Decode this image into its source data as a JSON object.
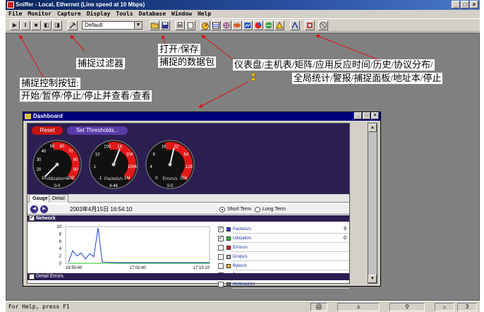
{
  "app": {
    "title": "Sniffer - Local, Ethernet (Line speed at 10 Mbps)",
    "window_buttons": [
      "_",
      "□",
      "×"
    ]
  },
  "menu": [
    "File",
    "Monitor",
    "Capture",
    "Display",
    "Tools",
    "Database",
    "Window",
    "Help"
  ],
  "toolbar": {
    "capture_buttons": [
      "▶",
      "‖",
      "■",
      "◧",
      "◨"
    ],
    "filter_value": "Default",
    "file_buttons": [
      "open-icon",
      "save-icon",
      "print-icon",
      "preview-icon"
    ],
    "monitor_buttons": [
      "dashboard-icon",
      "host-table-icon",
      "matrix-icon",
      "art-icon",
      "history-icon",
      "protocol-icon",
      "global-stats-icon",
      "alarm-icon",
      "capture-panel-icon",
      "address-book-icon",
      "stop-icon"
    ]
  },
  "status": {
    "help_text": "For Help, press F1",
    "count": "3"
  },
  "callouts": {
    "capture_control_1": "捕捉控制按钮:",
    "capture_control_2": "开始/暂停/停止/停止并查看/查看",
    "filter": "捕捉过滤器",
    "open_save_1": "打开/保存",
    "open_save_2": "捕捉的数据包",
    "monitor_1": "仪表盘/主机表/矩阵/应用反应时间/历史/协议分布/",
    "monitor_2": "全局统计/警报/捕捉面板/地址本/停止"
  },
  "dashboard": {
    "title": "Dashboard",
    "reset_label": "Reset",
    "thresholds_label": "Set Thresholds...",
    "gauges": [
      {
        "label": "Utilization%",
        "range": "0-0",
        "ticks": [
          "10",
          "20",
          "30",
          "40",
          "50",
          "60",
          "70",
          "80",
          "90",
          "100"
        ],
        "value_fraction": 0.0
      },
      {
        "label": "Packets/s",
        "range": "4-46",
        "ticks": [
          ".1",
          "1",
          "10",
          "100",
          "1K",
          "10K",
          "100K",
          "1M"
        ],
        "value_fraction": 0.58
      },
      {
        "label": "Errors/s",
        "range": "0-0",
        "ticks": [
          "0",
          "4",
          "8",
          "16",
          "32",
          "64",
          "128",
          "256"
        ],
        "value_fraction": 0.55
      }
    ],
    "gauge_tabs": [
      "Gauge",
      "Detail"
    ],
    "datetime": "2003年4月15日  16:54:10",
    "term_options": [
      "Short Term",
      "Long Term"
    ],
    "selected_term": "Short Term",
    "network_label": "Network",
    "detail_errors_label": "Detail Errors",
    "legend": [
      {
        "name": "Packets/s",
        "checked": true,
        "color": "#1a3ad8",
        "value": "9"
      },
      {
        "name": "Utilization",
        "checked": true,
        "color": "#22c022",
        "value": "0"
      },
      {
        "name": "Errors/s",
        "checked": false,
        "color": "#d81a1a",
        "value": ""
      },
      {
        "name": "Drops/s",
        "checked": false,
        "color": "#b0b0b0",
        "value": ""
      },
      {
        "name": "Bytes/s",
        "checked": false,
        "color": "#f0b020",
        "value": ""
      },
      {
        "name": "Broadcasts/s",
        "checked": false,
        "color": "#e040e0",
        "value": ""
      },
      {
        "name": "Multicasts/s",
        "checked": false,
        "color": "#606060",
        "value": ""
      }
    ]
  },
  "chart_data": {
    "type": "line",
    "x_ticks": [
      "16:50:40",
      "17:02:40",
      "17:15:10"
    ],
    "y_ticks": [
      "0",
      "2",
      "4",
      "6",
      "8",
      "10"
    ],
    "ylim": [
      0,
      10
    ],
    "series": [
      {
        "name": "Packets/s",
        "color": "#1a3ad8",
        "values": [
          0.3,
          3.4,
          2.0,
          2.8,
          1.2,
          2.6,
          1.8,
          9.6,
          0.3,
          0.2,
          0.2,
          0.2,
          0.2,
          0.2,
          0.2,
          0.2
        ]
      },
      {
        "name": "Utilization",
        "color": "#22c022",
        "values": [
          0,
          0,
          0,
          0,
          0,
          0,
          0,
          0,
          0,
          0,
          0,
          0,
          0,
          0,
          0,
          0
        ]
      }
    ]
  }
}
